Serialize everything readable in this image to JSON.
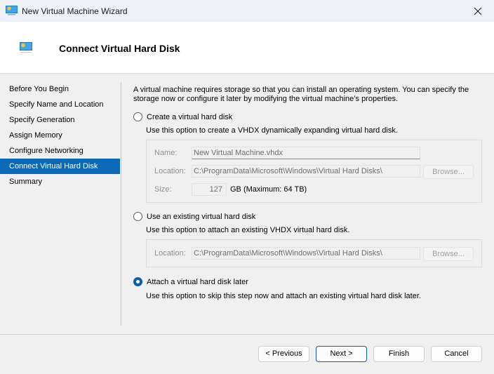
{
  "window": {
    "title": "New Virtual Machine Wizard",
    "close_icon": "close-icon",
    "app_icon": "virtual-machine-icon"
  },
  "header": {
    "title": "Connect Virtual Hard Disk",
    "icon": "virtual-machine-icon"
  },
  "nav": {
    "items": [
      {
        "label": "Before You Begin",
        "active": false
      },
      {
        "label": "Specify Name and Location",
        "active": false
      },
      {
        "label": "Specify Generation",
        "active": false
      },
      {
        "label": "Assign Memory",
        "active": false
      },
      {
        "label": "Configure Networking",
        "active": false
      },
      {
        "label": "Connect Virtual Hard Disk",
        "active": true
      },
      {
        "label": "Summary",
        "active": false
      }
    ]
  },
  "main": {
    "description": "A virtual machine requires storage so that you can install an operating system. You can specify the storage now or configure it later by modifying the virtual machine’s properties.",
    "options": {
      "create": {
        "label": "Create a virtual hard disk",
        "hint": "Use this option to create a VHDX dynamically expanding virtual hard disk.",
        "selected": false,
        "name_label": "Name:",
        "name_value": "New Virtual Machine.vhdx",
        "location_label": "Location:",
        "location_value": "C:\\ProgramData\\Microsoft\\Windows\\Virtual Hard Disks\\",
        "browse_label": "Browse...",
        "size_label": "Size:",
        "size_value": "127",
        "size_unit": "GB (Maximum: 64 TB)"
      },
      "existing": {
        "label": "Use an existing virtual hard disk",
        "hint": "Use this option to attach an existing VHDX virtual hard disk.",
        "selected": false,
        "location_label": "Location:",
        "location_value": "C:\\ProgramData\\Microsoft\\Windows\\Virtual Hard Disks\\",
        "browse_label": "Browse..."
      },
      "later": {
        "label": "Attach a virtual hard disk later",
        "hint": "Use this option to skip this step now and attach an existing virtual hard disk later.",
        "selected": true
      }
    }
  },
  "footer": {
    "previous_label": "< Previous",
    "next_label": "Next >",
    "finish_label": "Finish",
    "cancel_label": "Cancel"
  },
  "colors": {
    "accent": "#0a6ab8",
    "titlebar": "#eef2f8",
    "background": "#f0f0f0"
  }
}
